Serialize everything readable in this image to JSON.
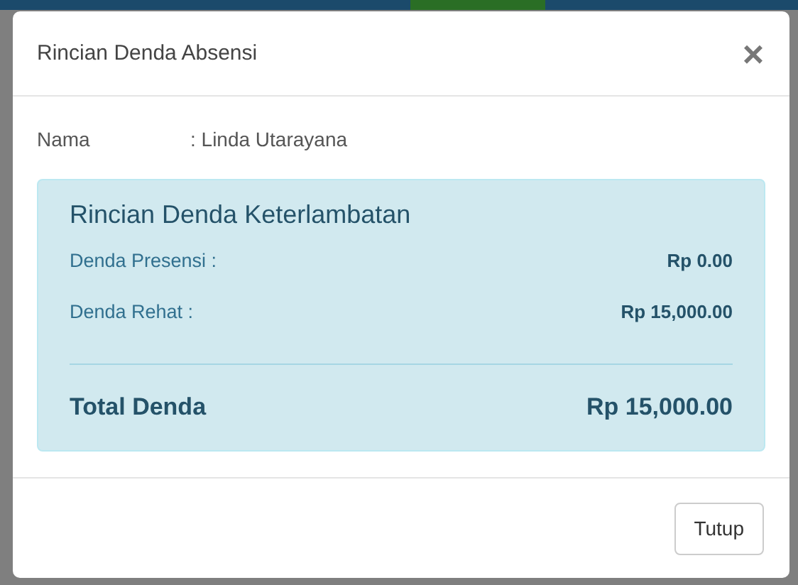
{
  "modal": {
    "title": "Rincian Denda Absensi",
    "close": "×"
  },
  "name_row": {
    "label": "Nama",
    "value": ": Linda Utarayana"
  },
  "summary": {
    "heading": "Rincian Denda Keterlambatan",
    "items": [
      {
        "label": "Denda Presensi :",
        "amount": "Rp 0.00"
      },
      {
        "label": "Denda Rehat :",
        "amount": "Rp 15,000.00"
      }
    ],
    "total_label": "Total Denda",
    "total_amount": "Rp 15,000.00"
  },
  "buttons": [
    "Tutup"
  ]
}
